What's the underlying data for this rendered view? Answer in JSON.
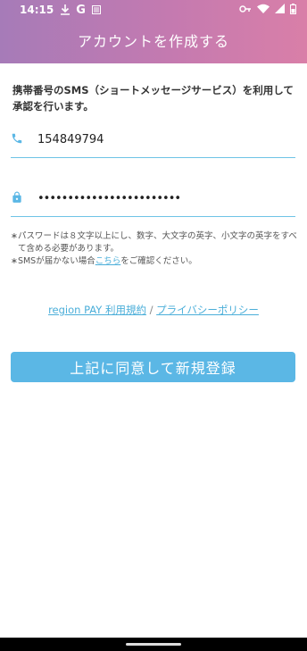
{
  "status_bar": {
    "time": "14:15",
    "left_icons": [
      "download-icon",
      "google-icon",
      "notification-icon"
    ],
    "right_icons": [
      "vpn-key-icon",
      "wifi-icon",
      "signal-icon",
      "battery-icon"
    ]
  },
  "header": {
    "title": "アカウントを作成する"
  },
  "description": "携帯番号のSMS（ショートメッセージサービス）を利用して承認を行います。",
  "phone_field": {
    "value": "154849794",
    "icon": "phone-icon"
  },
  "password_field": {
    "value": "••••••••••••••••••••••••",
    "icon": "lock-icon"
  },
  "notes": {
    "line1": "∗パスワードは８文字以上にし、数字、大文字の英字、小文字の英字をすべて含める必要があります。",
    "line2_prefix": "∗SMSが届かない場合",
    "line2_link": "こちら",
    "line2_suffix": "をご確認ください。"
  },
  "terms": {
    "terms_link": "region PAY 利用規約",
    "separator": " / ",
    "privacy_link": "プライバシーポリシー"
  },
  "submit_button": {
    "label": "上記に同意して新規登録"
  },
  "colors": {
    "accent": "#5bb7e5",
    "link": "#4aaed9",
    "header_start": "#a67bb8",
    "header_end": "#d97fa8"
  }
}
